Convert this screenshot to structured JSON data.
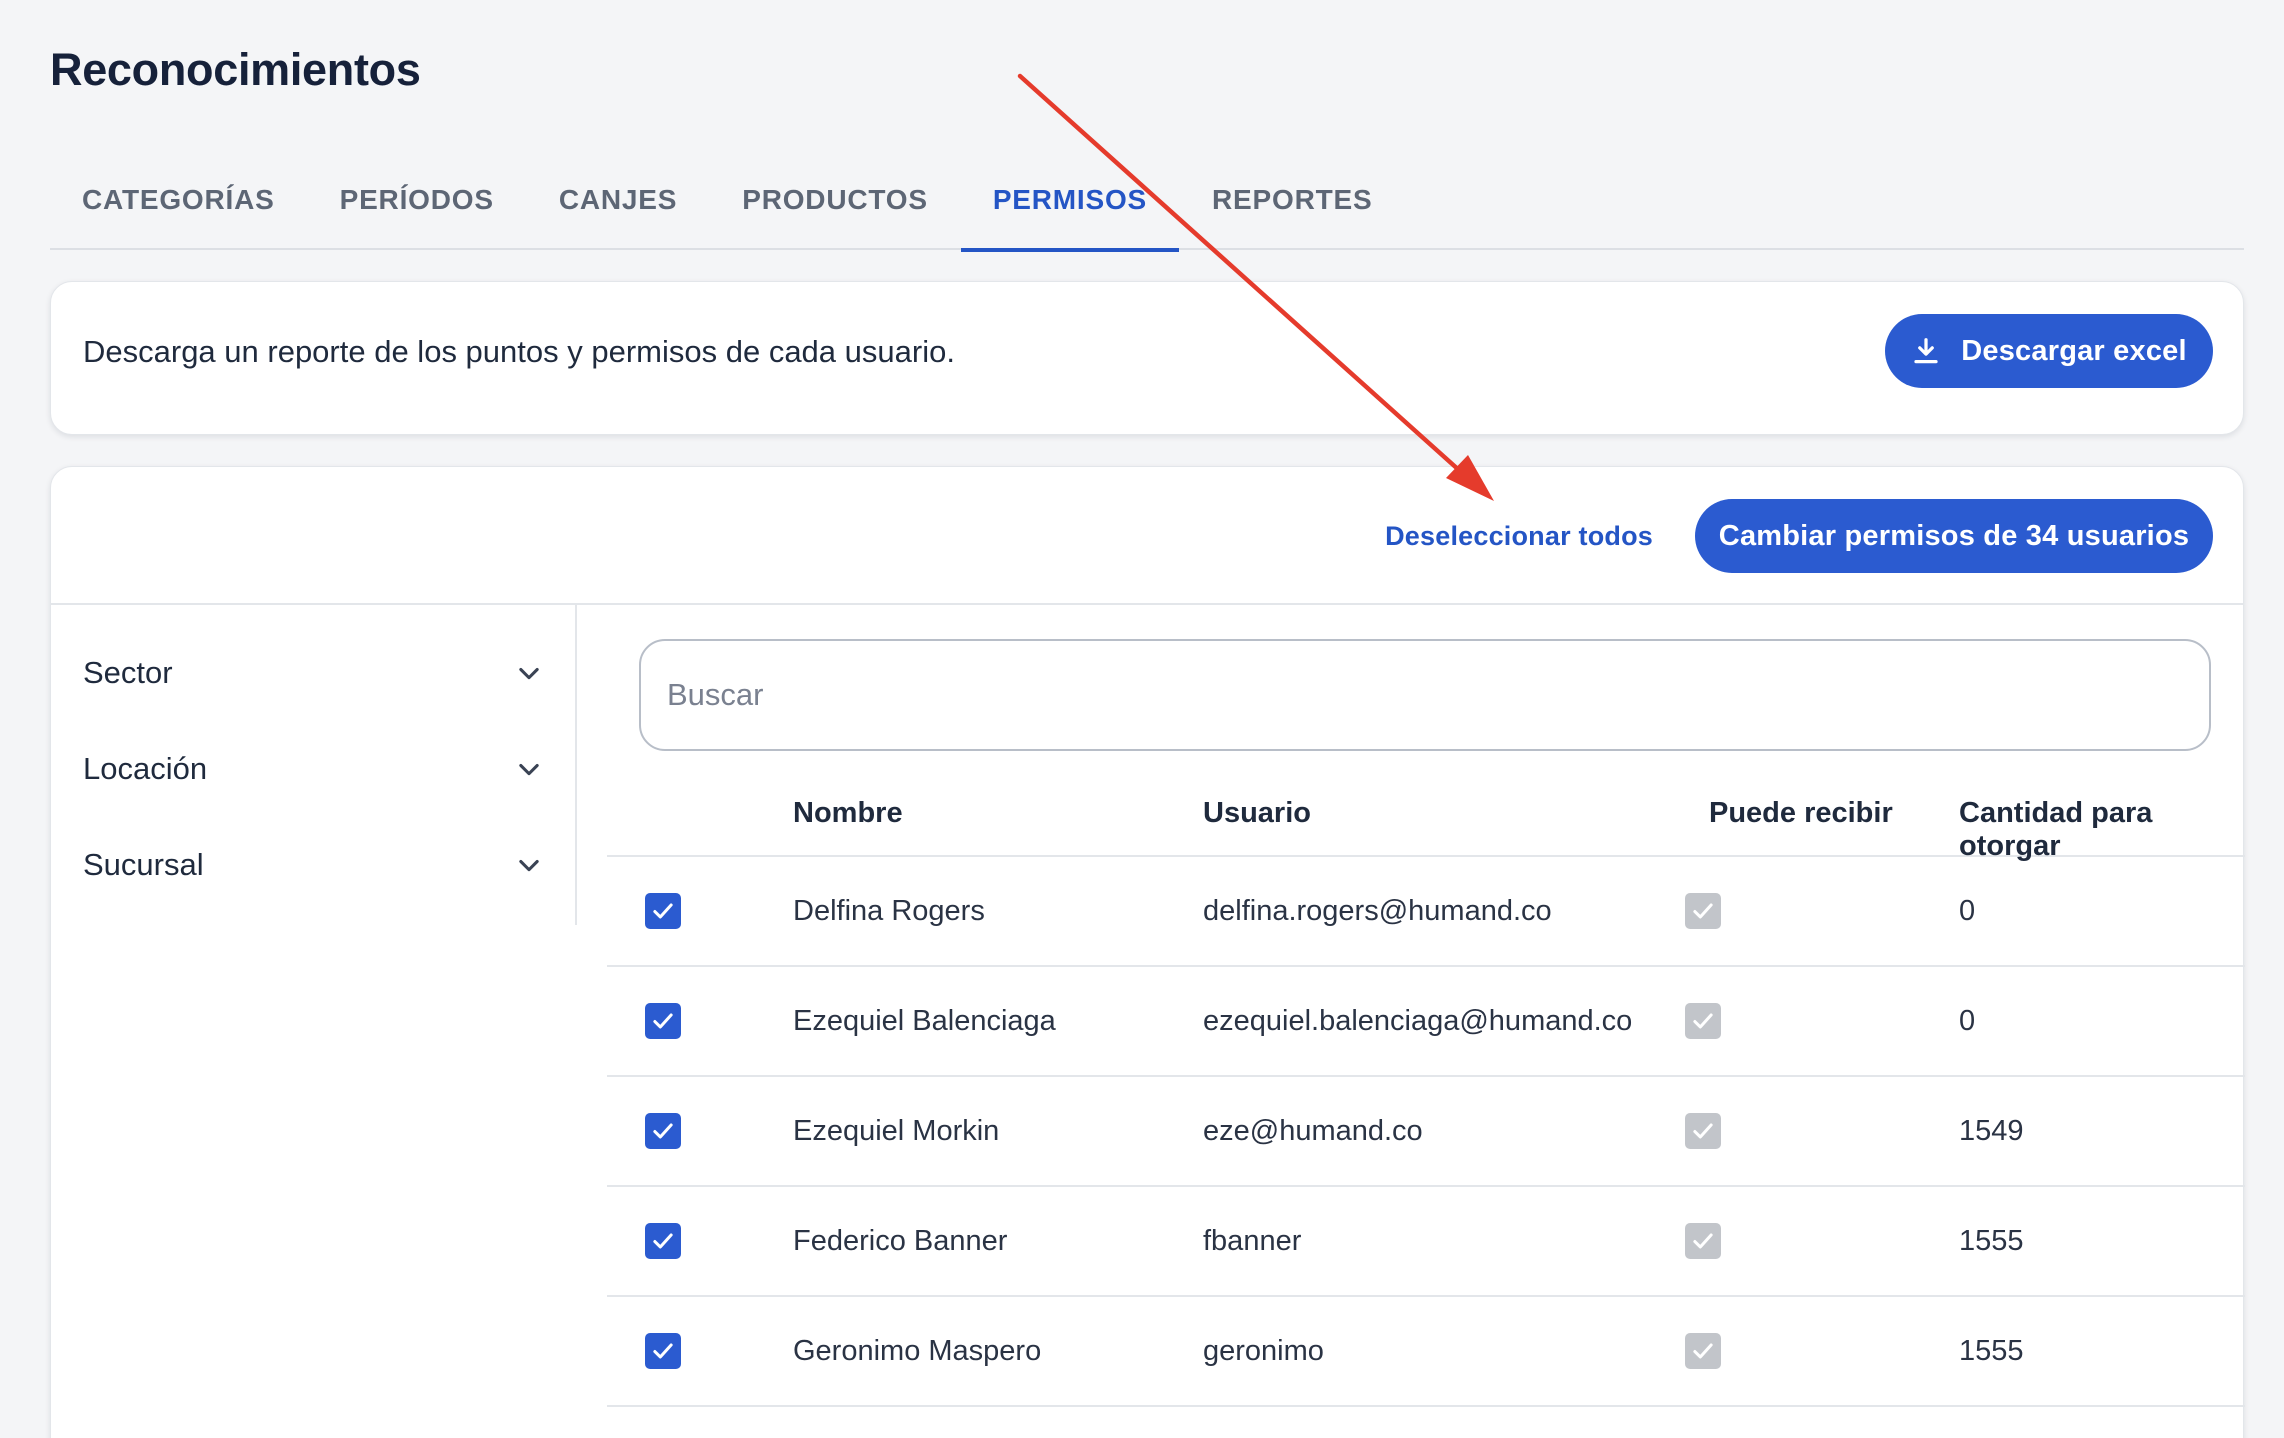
{
  "page": {
    "title": "Reconocimientos"
  },
  "tabs": [
    {
      "label": "CATEGORÍAS",
      "active": false
    },
    {
      "label": "PERÍODOS",
      "active": false
    },
    {
      "label": "CANJES",
      "active": false
    },
    {
      "label": "PRODUCTOS",
      "active": false
    },
    {
      "label": "PERMISOS",
      "active": true
    },
    {
      "label": "REPORTES",
      "active": false
    }
  ],
  "download_card": {
    "description": "Descarga un reporte de los puntos y permisos de cada usuario.",
    "button_label": "Descargar excel",
    "button_icon": "download-icon"
  },
  "actions": {
    "deselect_label": "Deseleccionar todos",
    "change_permissions_label": "Cambiar permisos de 34 usuarios"
  },
  "filters": [
    {
      "label": "Sector"
    },
    {
      "label": "Locación"
    },
    {
      "label": "Sucursal"
    }
  ],
  "search": {
    "placeholder": "Buscar",
    "value": ""
  },
  "table": {
    "columns": [
      "Nombre",
      "Usuario",
      "Puede recibir",
      "Cantidad para otorgar"
    ],
    "rows": [
      {
        "selected": true,
        "name": "Delfina Rogers",
        "user": "delfina.rogers@humand.co",
        "can_receive": true,
        "amount": "0"
      },
      {
        "selected": true,
        "name": "Ezequiel Balenciaga",
        "user": "ezequiel.balenciaga@humand.co",
        "can_receive": true,
        "amount": "0"
      },
      {
        "selected": true,
        "name": "Ezequiel Morkin",
        "user": "eze@humand.co",
        "can_receive": true,
        "amount": "1549"
      },
      {
        "selected": true,
        "name": "Federico Banner",
        "user": "fbanner",
        "can_receive": true,
        "amount": "1555"
      },
      {
        "selected": true,
        "name": "Geronimo Maspero",
        "user": "geronimo",
        "can_receive": true,
        "amount": "1555"
      }
    ]
  },
  "colors": {
    "primary": "#2b5bd0",
    "tab_active": "#2455c5",
    "annotation_arrow": "#e53b2c",
    "disabled_checkbox": "#c2c5ca"
  }
}
